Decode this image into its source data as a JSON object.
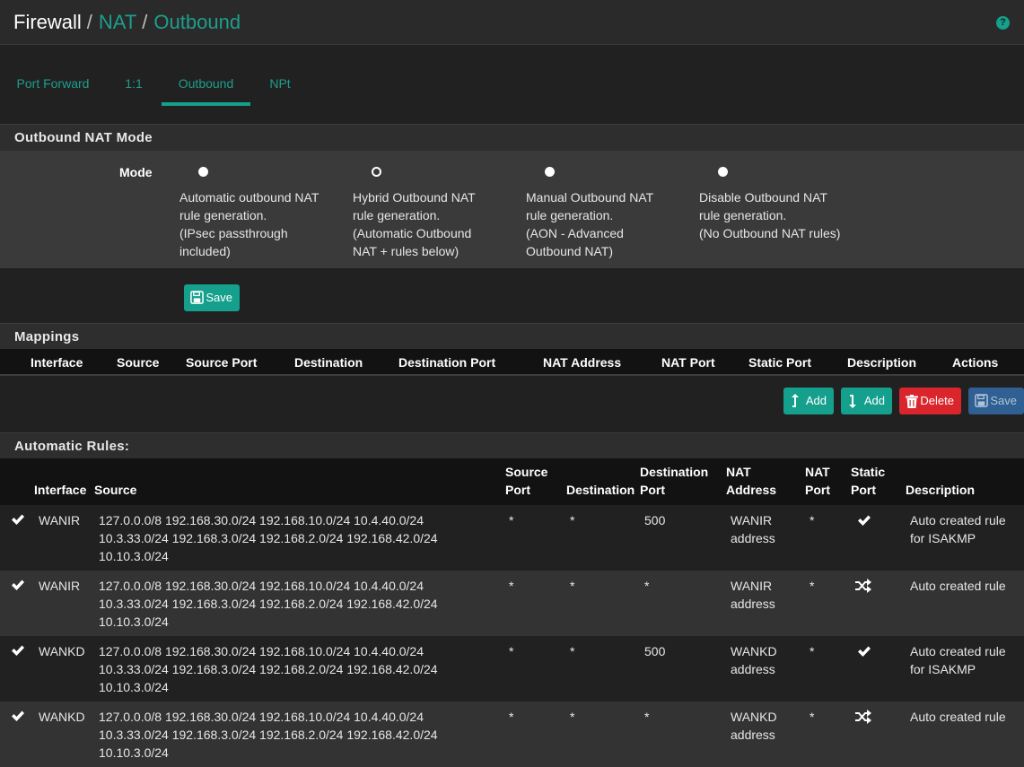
{
  "header": {
    "crumb1": "Firewall",
    "crumb2": "NAT",
    "crumb3": "Outbound",
    "sep": "/",
    "help_icon": "?"
  },
  "tabs": [
    {
      "label": "Port Forward",
      "active": false
    },
    {
      "label": "1:1",
      "active": false
    },
    {
      "label": "Outbound",
      "active": true
    },
    {
      "label": "NPt",
      "active": false
    }
  ],
  "mode_section": {
    "title": "Outbound NAT Mode",
    "mode_label": "Mode",
    "options": [
      {
        "line1": "Automatic outbound NAT",
        "line2": "rule generation.",
        "line3": "(IPsec passthrough",
        "line4": "included)",
        "selected": true
      },
      {
        "line1": "Hybrid Outbound NAT",
        "line2": "rule generation.",
        "line3": "(Automatic Outbound",
        "line4": "NAT + rules below)",
        "selected": false
      },
      {
        "line1": "Manual Outbound NAT",
        "line2": "rule generation.",
        "line3": "(AON - Advanced",
        "line4": "Outbound NAT)",
        "selected": false
      },
      {
        "line1": "Disable Outbound NAT",
        "line2": "rule generation.",
        "line3": "(No Outbound NAT rules)",
        "line4": "",
        "selected": false
      }
    ],
    "save_label": "Save"
  },
  "mappings": {
    "title": "Mappings",
    "columns": [
      "Interface",
      "Source",
      "Source Port",
      "Destination",
      "Destination Port",
      "NAT Address",
      "NAT Port",
      "Static Port",
      "Description",
      "Actions"
    ],
    "buttons": {
      "add_top": "Add",
      "add_bottom": "Add",
      "delete": "Delete",
      "save": "Save"
    }
  },
  "automatic_rules": {
    "title": "Automatic Rules:",
    "columns": {
      "interface": "Interface",
      "source": "Source",
      "source_port_1": "Source",
      "source_port_2": "Port",
      "destination": "Destination",
      "dest_port_1": "Destination",
      "dest_port_2": "Port",
      "nat_address_1": "NAT",
      "nat_address_2": "Address",
      "nat_port_1": "NAT",
      "nat_port_2": "Port",
      "static_port_1": "Static",
      "static_port_2": "Port",
      "description": "Description"
    },
    "rows": [
      {
        "interface": "WANIR",
        "source_1": "127.0.0.0/8 192.168.30.0/24 192.168.10.0/24 10.4.40.0/24",
        "source_2": "10.3.33.0/24 192.168.3.0/24 192.168.2.0/24 192.168.42.0/24",
        "source_3": "10.10.3.0/24",
        "source_port": "*",
        "destination": "*",
        "dest_port": "500",
        "nat_address_1": "WANIR",
        "nat_address_2": "address",
        "nat_port": "*",
        "static_port": "check",
        "description_1": "Auto created rule",
        "description_2": "for ISAKMP"
      },
      {
        "interface": "WANIR",
        "source_1": "127.0.0.0/8 192.168.30.0/24 192.168.10.0/24 10.4.40.0/24",
        "source_2": "10.3.33.0/24 192.168.3.0/24 192.168.2.0/24 192.168.42.0/24",
        "source_3": "10.10.3.0/24",
        "source_port": "*",
        "destination": "*",
        "dest_port": "*",
        "nat_address_1": "WANIR",
        "nat_address_2": "address",
        "nat_port": "*",
        "static_port": "random",
        "description_1": "Auto created rule",
        "description_2": ""
      },
      {
        "interface": "WANKD",
        "source_1": "127.0.0.0/8 192.168.30.0/24 192.168.10.0/24 10.4.40.0/24",
        "source_2": "10.3.33.0/24 192.168.3.0/24 192.168.2.0/24 192.168.42.0/24",
        "source_3": "10.10.3.0/24",
        "source_port": "*",
        "destination": "*",
        "dest_port": "500",
        "nat_address_1": "WANKD",
        "nat_address_2": "address",
        "nat_port": "*",
        "static_port": "check",
        "description_1": "Auto created rule",
        "description_2": "for ISAKMP"
      },
      {
        "interface": "WANKD",
        "source_1": "127.0.0.0/8 192.168.30.0/24 192.168.10.0/24 10.4.40.0/24",
        "source_2": "10.3.33.0/24 192.168.3.0/24 192.168.2.0/24 192.168.42.0/24",
        "source_3": "10.10.3.0/24",
        "source_port": "*",
        "destination": "*",
        "dest_port": "*",
        "nat_address_1": "WANKD",
        "nat_address_2": "address",
        "nat_port": "*",
        "static_port": "random",
        "description_1": "Auto created rule",
        "description_2": ""
      }
    ]
  },
  "colors": {
    "accent": "#14a08c",
    "danger": "#d9252b",
    "primary": "#2f5f93"
  }
}
